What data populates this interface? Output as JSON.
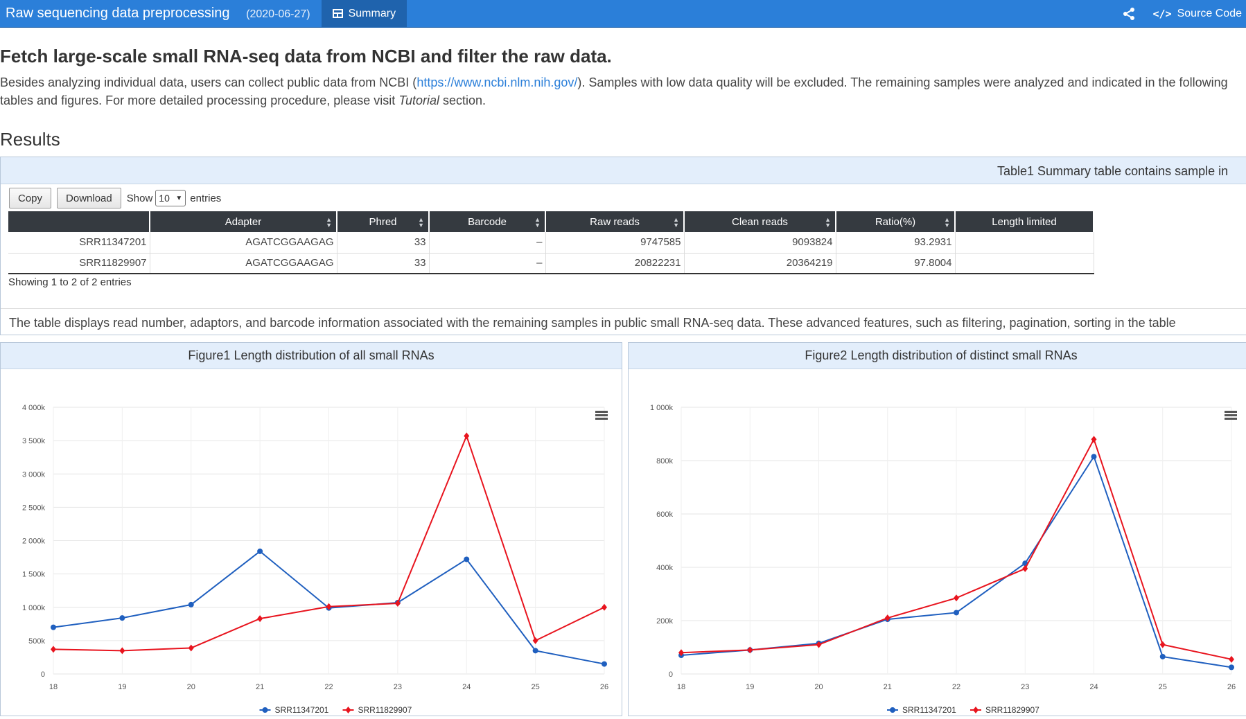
{
  "navbar": {
    "title": "Raw sequencing data preprocessing",
    "date": "(2020-06-27)",
    "tab_label": "Summary",
    "tab_icon": "table-icon",
    "share_icon": "share-icon",
    "source_label": "Source Code",
    "source_icon": "code-icon"
  },
  "page": {
    "heading": "Fetch large-scale small RNA-seq data from NCBI and filter the raw data.",
    "intro_part1": "Besides analyzing individual data, users can collect public data from NCBI (",
    "intro_link": "https://www.ncbi.nlm.nih.gov/",
    "intro_part2": "). Samples with low data quality will be excluded. The remaining samples were analyzed and indicated in the following tables and figures. For more detailed processing procedure, please visit ",
    "intro_italic": "Tutorial",
    "intro_part3": " section.",
    "results_heading": "Results"
  },
  "table_panel": {
    "caption": "Table1 Summary table contains sample in",
    "copy_label": "Copy",
    "download_label": "Download",
    "show_label": "Show",
    "entries_value": "10",
    "entries_label": "entries",
    "columns": [
      "",
      "Adapter",
      "Phred",
      "Barcode",
      "Raw reads",
      "Clean reads",
      "Ratio(%)",
      "Length limited"
    ],
    "rows": [
      [
        "SRR11347201",
        "AGATCGGAAGAG",
        "33",
        "–",
        "9747585",
        "9093824",
        "93.2931",
        ""
      ],
      [
        "SRR11829907",
        "AGATCGGAAGAG",
        "33",
        "–",
        "20822231",
        "20364219",
        "97.8004",
        ""
      ]
    ],
    "showing_text": "Showing 1 to 2 of 2 entries",
    "description": "The table displays read number, adaptors, and barcode information associated with the remaining samples in public small RNA-seq data. These advanced features, such as filtering, pagination, sorting in the table"
  },
  "figures": {
    "fig1_title": "Figure1 Length distribution of all small RNAs",
    "fig2_title": "Figure2 Length distribution of distinct small RNAs",
    "menu_icon": "hamburger-menu-icon"
  },
  "chart_data": [
    {
      "type": "line",
      "title": "Figure1 Length distribution of all small RNAs",
      "xlabel": "",
      "ylabel": "",
      "x": [
        18,
        19,
        20,
        21,
        22,
        23,
        24,
        25,
        26
      ],
      "ylim": [
        0,
        4000000
      ],
      "yticks": [
        0,
        500000,
        1000000,
        1500000,
        2000000,
        2500000,
        3000000,
        3500000,
        4000000
      ],
      "ytick_labels": [
        "0",
        "500k",
        "1 000k",
        "1 500k",
        "2 000k",
        "2 500k",
        "3 000k",
        "3 500k",
        "4 000k"
      ],
      "grid": true,
      "legend": "bottom-center",
      "series": [
        {
          "name": "SRR11347201",
          "color": "#1f5fbf",
          "marker": "circle",
          "values": [
            700000,
            840000,
            1040000,
            1840000,
            990000,
            1070000,
            1720000,
            350000,
            150000
          ]
        },
        {
          "name": "SRR11829907",
          "color": "#e8141e",
          "marker": "diamond",
          "values": [
            370000,
            350000,
            390000,
            830000,
            1010000,
            1060000,
            3570000,
            500000,
            1000000
          ]
        }
      ]
    },
    {
      "type": "line",
      "title": "Figure2 Length distribution of distinct small RNAs",
      "xlabel": "",
      "ylabel": "",
      "x": [
        18,
        19,
        20,
        21,
        22,
        23,
        24,
        25,
        26
      ],
      "ylim": [
        0,
        1000000
      ],
      "yticks": [
        0,
        200000,
        400000,
        600000,
        800000,
        1000000
      ],
      "ytick_labels": [
        "0",
        "200k",
        "400k",
        "600k",
        "800k",
        "1 000k"
      ],
      "grid": true,
      "legend": "bottom-center",
      "series": [
        {
          "name": "SRR11347201",
          "color": "#1f5fbf",
          "marker": "circle",
          "values": [
            70000,
            90000,
            115000,
            205000,
            230000,
            415000,
            815000,
            65000,
            25000
          ]
        },
        {
          "name": "SRR11829907",
          "color": "#e8141e",
          "marker": "diamond",
          "values": [
            80000,
            90000,
            110000,
            210000,
            285000,
            395000,
            880000,
            110000,
            55000
          ]
        }
      ]
    }
  ]
}
